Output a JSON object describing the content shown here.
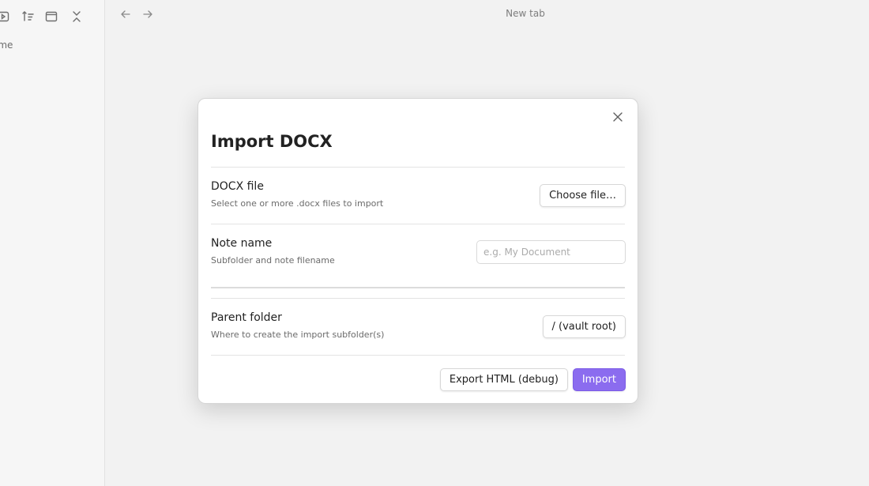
{
  "sidebar": {
    "toolbar_icons": [
      "play-icon",
      "sort-icon",
      "window-icon",
      "collapse-icon"
    ],
    "home_label": "ome"
  },
  "topbar": {
    "tab_title": "New tab"
  },
  "modal": {
    "title": "Import DOCX",
    "docx_file": {
      "name": "DOCX file",
      "description": "Select one or more .docx files to import",
      "button_label": "Choose file…"
    },
    "note_name": {
      "name": "Note name",
      "description": "Subfolder and note filename",
      "placeholder": "e.g. My Document",
      "value": ""
    },
    "parent_folder": {
      "name": "Parent folder",
      "description": "Where to create the import subfolder(s)",
      "button_label": "/ (vault root)"
    },
    "footer": {
      "export_label": "Export HTML (debug)",
      "import_label": "Import"
    }
  },
  "colors": {
    "accent": "#8b6cef",
    "background": "#f2f2f2"
  }
}
